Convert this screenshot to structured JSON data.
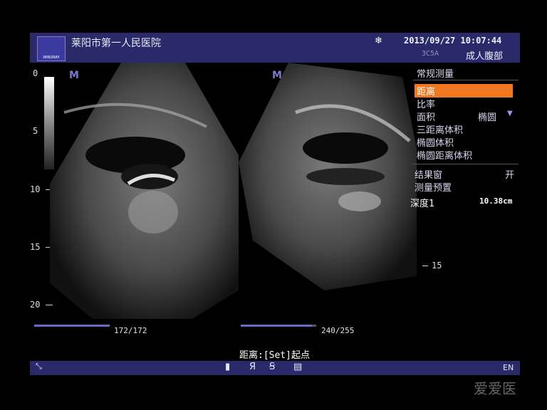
{
  "header": {
    "hospital": "莱阳市第一人民医院",
    "logo_text": "WINDRAY",
    "datetime": "2013/09/27  10:07:44",
    "probe": "3C5A",
    "preset": "成人腹部"
  },
  "depth_scale": {
    "labels": [
      "0",
      "5",
      "10",
      "15",
      "20"
    ]
  },
  "right_depth": "15",
  "menu": {
    "title": "常规测量",
    "items": [
      "距离",
      "比率",
      "面积",
      "三距离体积",
      "椭圆体积",
      "椭圆距离体积"
    ],
    "area_value": "椭圆",
    "result_window_label": "结果窗",
    "result_window_value": "开",
    "preset_label": "测量预置",
    "depth_label": "深度1",
    "depth_value": "10.38cm"
  },
  "cine": {
    "left": "172/172",
    "right": "240/255"
  },
  "status_caption": "距离:[Set]起点",
  "bottombar": {
    "lang": "EN"
  },
  "watermark": "爱爱医"
}
